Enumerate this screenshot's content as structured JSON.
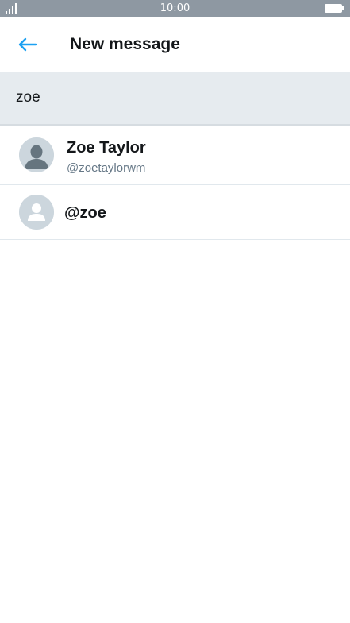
{
  "status_bar": {
    "time": "10:00",
    "signal_icon": "signal-icon",
    "battery_icon": "battery-icon"
  },
  "app_bar": {
    "back_icon": "arrow-left-icon",
    "title": "New message"
  },
  "search": {
    "value": "zoe"
  },
  "results": [
    {
      "name": "Zoe Taylor",
      "screen_name": "@zoetaylorwm",
      "avatar_icon": "default-profile-avatar"
    },
    {
      "handle": "@zoe",
      "avatar_icon": "generic-user-avatar"
    }
  ],
  "colors": {
    "accent": "#1da1f2",
    "status_bar": "#8e98a2",
    "search_bg": "#e6ebef",
    "secondary_text": "#657786"
  }
}
